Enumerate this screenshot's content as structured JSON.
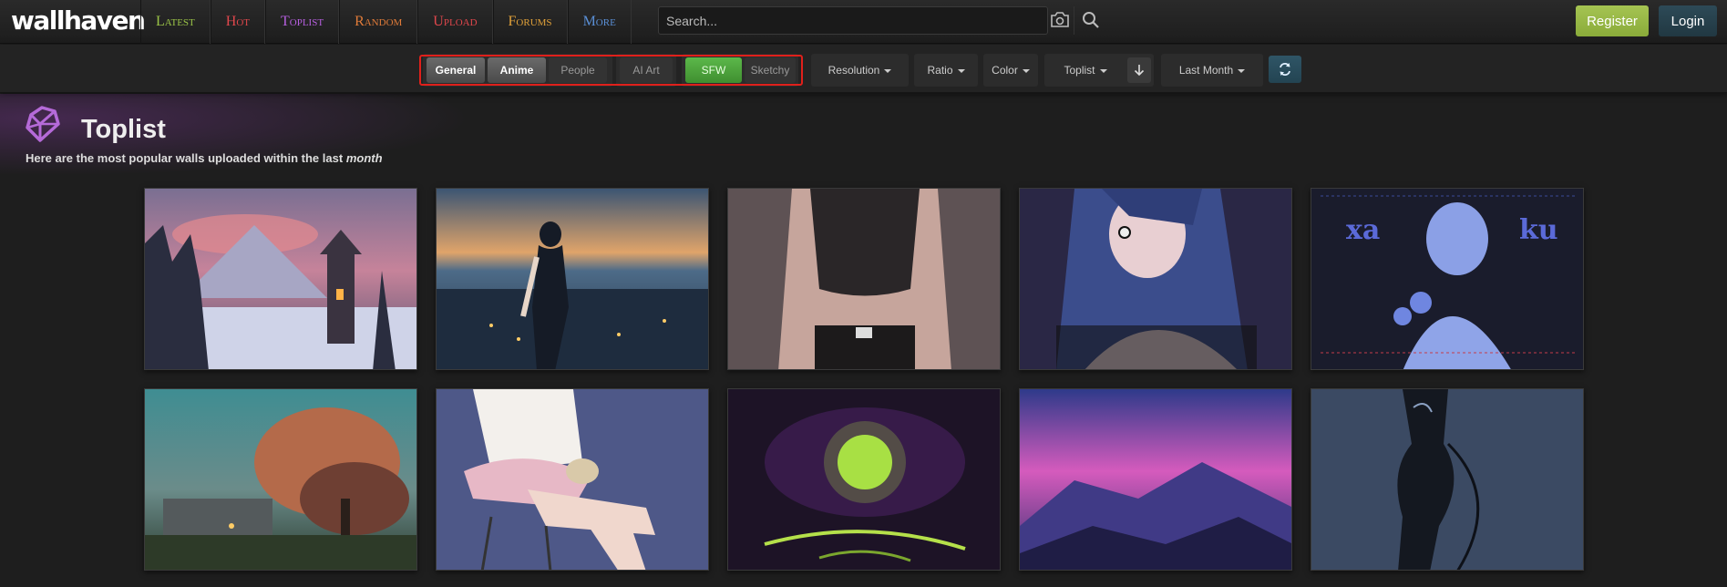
{
  "header": {
    "logo": "wallhaven",
    "nav": [
      {
        "label": "Latest",
        "color": "#9bc447"
      },
      {
        "label": "Hot",
        "color": "#e0474c"
      },
      {
        "label": "Toplist",
        "color": "#b75fe0"
      },
      {
        "label": "Random",
        "color": "#e07b39"
      },
      {
        "label": "Upload",
        "color": "#e0474c"
      },
      {
        "label": "Forums",
        "color": "#e0a039"
      },
      {
        "label": "More",
        "color": "#5a8fd6"
      }
    ],
    "search_placeholder": "Search...",
    "register_label": "Register",
    "login_label": "Login"
  },
  "filters": {
    "categories": [
      {
        "label": "General",
        "active": true
      },
      {
        "label": "Anime",
        "active": true
      },
      {
        "label": "People",
        "active": false
      }
    ],
    "ai_art_label": "AI Art",
    "purity": [
      {
        "label": "SFW",
        "active": true,
        "color": "#4ca33c"
      },
      {
        "label": "Sketchy",
        "active": false
      }
    ],
    "resolution_label": "Resolution",
    "ratio_label": "Ratio",
    "color_label": "Color",
    "sorting_label": "Toplist",
    "range_label": "Last Month",
    "icons": {
      "order": "arrow-down-icon",
      "refresh": "refresh-icon"
    }
  },
  "page": {
    "title": "Toplist",
    "subtitle_prefix": "Here are the most popular walls uploaded within the last",
    "subtitle_emphasis": "month",
    "title_icon": "gem-icon"
  },
  "thumbnails": [
    {
      "subject": "winter-tower"
    },
    {
      "subject": "girl-city-dusk"
    },
    {
      "subject": "tank-top-figure"
    },
    {
      "subject": "blue-hair-girl"
    },
    {
      "subject": "blue-flower-girl"
    },
    {
      "subject": "sunset-tree"
    },
    {
      "subject": "sitting-girl"
    },
    {
      "subject": "green-moon"
    },
    {
      "subject": "pink-mountain-sky"
    },
    {
      "subject": "dark-figure"
    }
  ]
}
